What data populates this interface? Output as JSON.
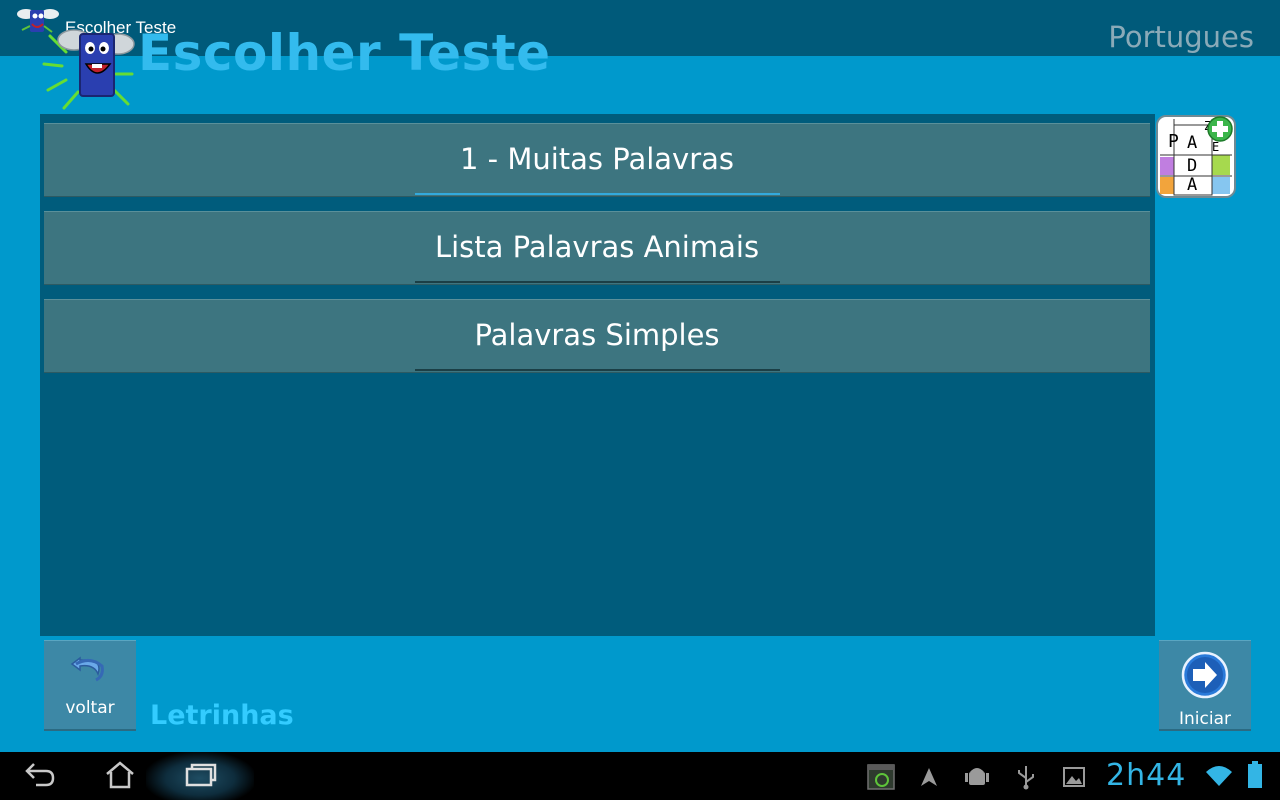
{
  "titlebar": {
    "title": "Escolher Teste",
    "icon": "mascot-icon"
  },
  "header": {
    "title": "Escolher Teste",
    "language": "Portugues"
  },
  "tests": [
    {
      "label": "1 - Muitas Palavras",
      "selected": true
    },
    {
      "label": "Lista Palavras Animais",
      "selected": false
    },
    {
      "label": "Palavras Simples",
      "selected": false
    }
  ],
  "puzzle_icon": {
    "letters": [
      "P",
      "A",
      "D",
      "A",
      "Z",
      "E"
    ],
    "icon": "word-puzzle-add-icon"
  },
  "bottom": {
    "back_label": "voltar",
    "start_label": "Iniciar",
    "app_name": "Letrinhas"
  },
  "statusbar": {
    "time": "2h44"
  },
  "colors": {
    "background": "#0099cc",
    "panel": "#005c7c",
    "item": "#3d7580",
    "accent": "#33b5e5"
  }
}
